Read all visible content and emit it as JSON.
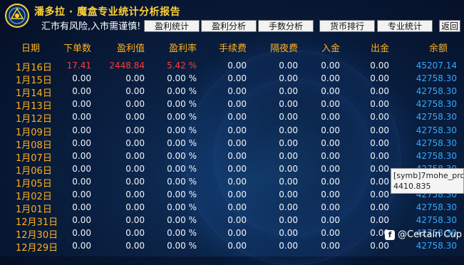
{
  "app": {
    "title": "潘多拉 · 魔盒专业统计分析报告",
    "subtitle": "汇市有风险,入市需谨慎!"
  },
  "nav": {
    "profit_stats": "盈利统计",
    "profit_analysis": "盈利分析",
    "lots_analysis": "手数分析",
    "currency_rank": "货币排行",
    "pro_stats": "专业统计",
    "back": "返回"
  },
  "columns": {
    "date": "日期",
    "lots": "下单数",
    "profit": "盈利值",
    "rate": "盈利率",
    "commission": "手续费",
    "swap": "隔夜费",
    "deposit": "入金",
    "withdraw": "出金",
    "balance": "余额"
  },
  "rows": [
    {
      "date": "1月16日",
      "lots": "17.41",
      "profit": "2448.84",
      "rate": "5.42 %",
      "commission": "0.00",
      "swap": "0.00",
      "deposit": "0.00",
      "withdraw": "0.00",
      "balance": "45207.14"
    },
    {
      "date": "1月15日",
      "lots": "0.00",
      "profit": "0.00",
      "rate": "0.00 %",
      "commission": "0.00",
      "swap": "0.00",
      "deposit": "0.00",
      "withdraw": "0.00",
      "balance": "42758.30"
    },
    {
      "date": "1月14日",
      "lots": "0.00",
      "profit": "0.00",
      "rate": "0.00 %",
      "commission": "0.00",
      "swap": "0.00",
      "deposit": "0.00",
      "withdraw": "0.00",
      "balance": "42758.30"
    },
    {
      "date": "1月13日",
      "lots": "0.00",
      "profit": "0.00",
      "rate": "0.00 %",
      "commission": "0.00",
      "swap": "0.00",
      "deposit": "0.00",
      "withdraw": "0.00",
      "balance": "42758.30"
    },
    {
      "date": "1月12日",
      "lots": "0.00",
      "profit": "0.00",
      "rate": "0.00 %",
      "commission": "0.00",
      "swap": "0.00",
      "deposit": "0.00",
      "withdraw": "0.00",
      "balance": "42758.30"
    },
    {
      "date": "1月09日",
      "lots": "0.00",
      "profit": "0.00",
      "rate": "0.00 %",
      "commission": "0.00",
      "swap": "0.00",
      "deposit": "0.00",
      "withdraw": "0.00",
      "balance": "42758.30"
    },
    {
      "date": "1月08日",
      "lots": "0.00",
      "profit": "0.00",
      "rate": "0.00 %",
      "commission": "0.00",
      "swap": "0.00",
      "deposit": "0.00",
      "withdraw": "0.00",
      "balance": "42758.30"
    },
    {
      "date": "1月07日",
      "lots": "0.00",
      "profit": "0.00",
      "rate": "0.00 %",
      "commission": "0.00",
      "swap": "0.00",
      "deposit": "0.00",
      "withdraw": "0.00",
      "balance": "42758.30"
    },
    {
      "date": "1月06日",
      "lots": "0.00",
      "profit": "0.00",
      "rate": "0.00 %",
      "commission": "0.00",
      "swap": "0.00",
      "deposit": "0.00",
      "withdraw": "0.00",
      "balance": "42758.30"
    },
    {
      "date": "1月05日",
      "lots": "0.00",
      "profit": "0.00",
      "rate": "0.00 %",
      "commission": "0.00",
      "swap": "0.00",
      "deposit": "0.00",
      "withdraw": "0.00",
      "balance": "42758.30"
    },
    {
      "date": "1月02日",
      "lots": "0.00",
      "profit": "0.00",
      "rate": "0.00 %",
      "commission": "0.00",
      "swap": "0.00",
      "deposit": "0.00",
      "withdraw": "0.00",
      "balance": "42758.30"
    },
    {
      "date": "1月01日",
      "lots": "0.00",
      "profit": "0.00",
      "rate": "0.00 %",
      "commission": "0.00",
      "swap": "0.00",
      "deposit": "0.00",
      "withdraw": "0.00",
      "balance": "42758.30"
    },
    {
      "date": "12月31日",
      "lots": "0.00",
      "profit": "0.00",
      "rate": "0.00 %",
      "commission": "0.00",
      "swap": "0.00",
      "deposit": "0.00",
      "withdraw": "0.00",
      "balance": "42758.30"
    },
    {
      "date": "12月30日",
      "lots": "0.00",
      "profit": "0.00",
      "rate": "0.00 %",
      "commission": "0.00",
      "swap": "0.00",
      "deposit": "0.00",
      "withdraw": "0.00",
      "balance": "42758.30"
    },
    {
      "date": "12月29日",
      "lots": "0.00",
      "profit": "0.00",
      "rate": "0.00 %",
      "commission": "0.00",
      "swap": "0.00",
      "deposit": "0.00",
      "withdraw": "0.00",
      "balance": "42758.30"
    }
  ],
  "tooltip": {
    "line1": "[symb]7mohe_pro",
    "line2": "4410.835"
  },
  "watermark": {
    "icon": "f",
    "text": "@Certain Cup"
  },
  "colors": {
    "header_text": "#ffd23a",
    "column_text": "#ffb01e",
    "profit_red": "#ff3b3b",
    "balance_blue": "#34a8ff"
  }
}
